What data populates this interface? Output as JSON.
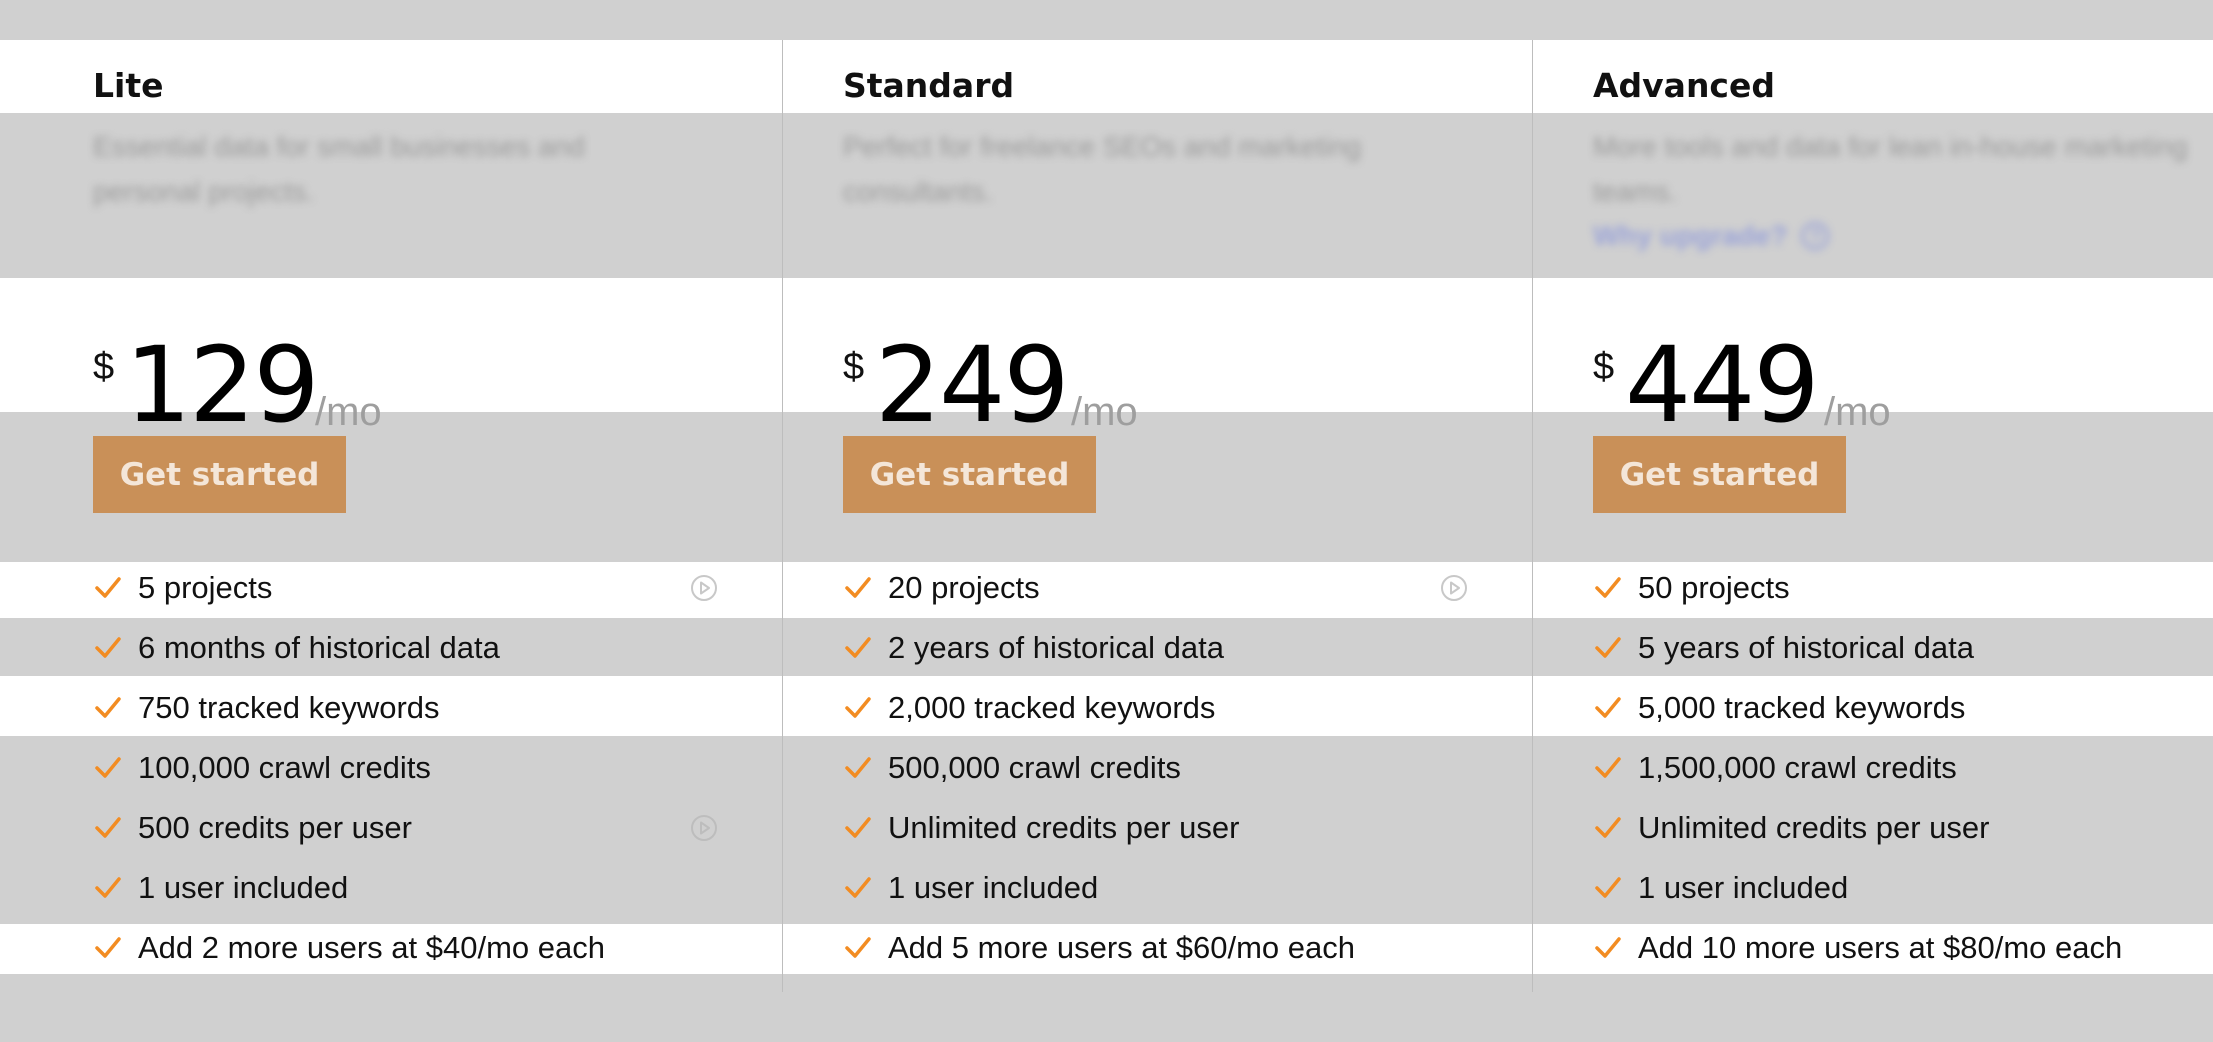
{
  "colors": {
    "accent": "#f28c22",
    "button": "#c99058",
    "overlay": "#d0d0d0"
  },
  "plans": [
    {
      "name": "Lite",
      "description": "Essential data for small businesses and personal projects.",
      "currency": "$",
      "price": "129",
      "period": "/mo",
      "cta": "Get started",
      "features": [
        "5 projects",
        "6 months of historical data",
        "750 tracked keywords",
        "100,000 crawl credits",
        "500 credits per user",
        "1 user included",
        "Add 2 more users at $40/mo each"
      ]
    },
    {
      "name": "Standard",
      "description": "Perfect for freelance SEOs and marketing consultants.",
      "currency": "$",
      "price": "249",
      "period": "/mo",
      "cta": "Get started",
      "features": [
        "20 projects",
        "2 years of historical data",
        "2,000 tracked keywords",
        "500,000 crawl credits",
        "Unlimited credits per user",
        "1 user included",
        "Add 5 more users at $60/mo each"
      ]
    },
    {
      "name": "Advanced",
      "description": "More tools and data for lean in-house marketing teams.",
      "upgrade_link": "Why upgrade?",
      "currency": "$",
      "price": "449",
      "period": "/mo",
      "cta": "Get started",
      "features": [
        "50 projects",
        "5 years of historical data",
        "5,000 tracked keywords",
        "1,500,000 crawl credits",
        "Unlimited credits per user",
        "1 user included",
        "Add 10 more users at $80/mo each"
      ]
    }
  ]
}
